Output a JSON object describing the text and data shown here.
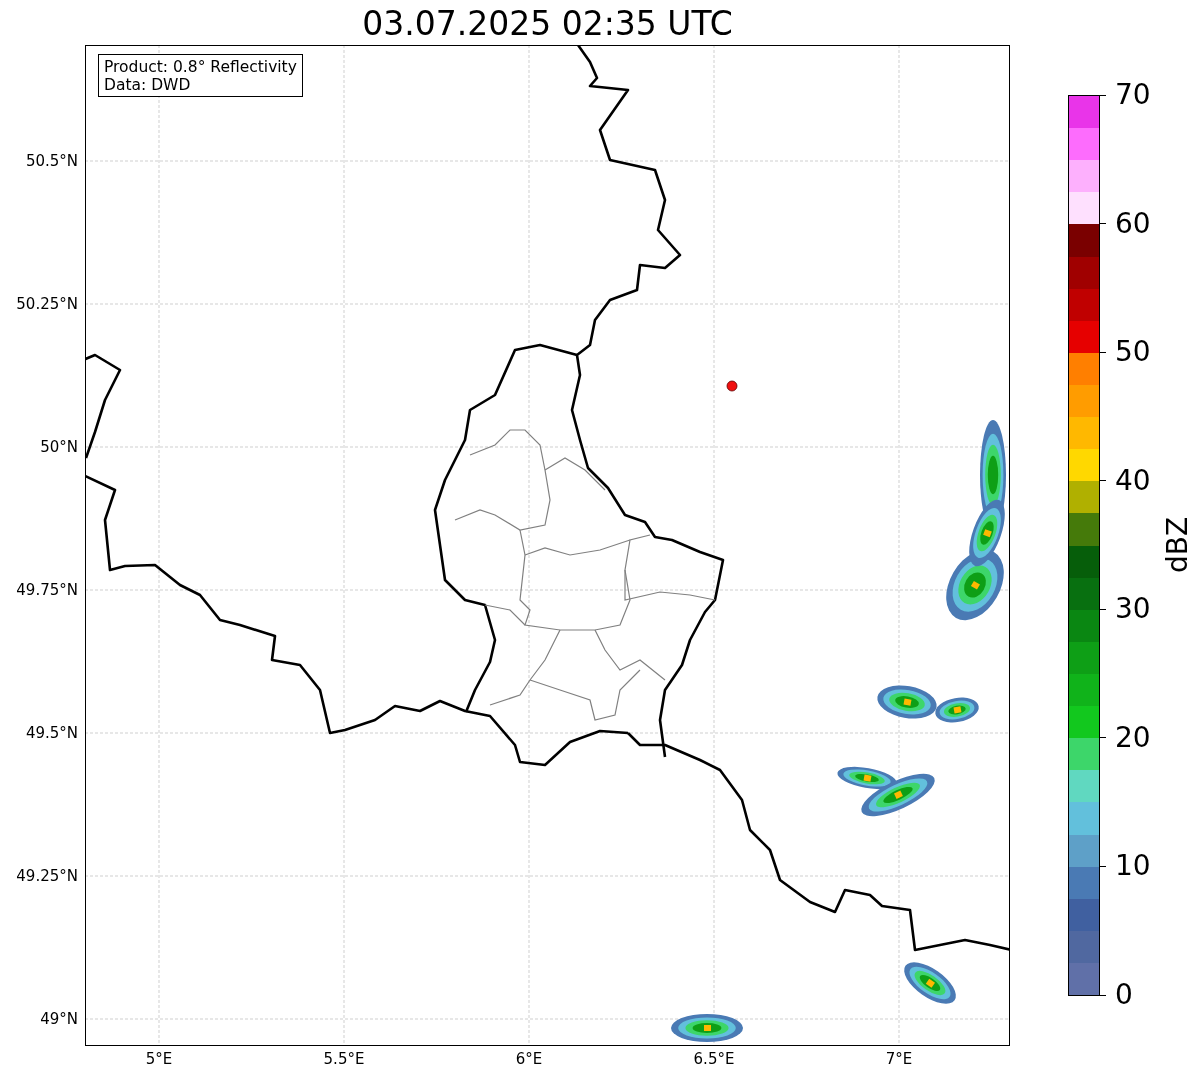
{
  "title": "03.07.2025 02:35 UTC",
  "map": {
    "info_box": [
      "Product: 0.8° Reflectivity",
      "Data: DWD"
    ],
    "xticks": [
      "5°E",
      "5.5°E",
      "6°E",
      "6.5°E",
      "7°E"
    ],
    "yticks": [
      "50.5°N",
      "50.25°N",
      "50°N",
      "49.75°N",
      "49.5°N",
      "49.25°N",
      "49°N"
    ]
  },
  "colorbar": {
    "label": "dBZ",
    "ticks": [
      "70",
      "60",
      "50",
      "40",
      "30",
      "20",
      "10",
      "0"
    ],
    "bands": [
      {
        "color": "#e934e9"
      },
      {
        "color": "#fd6cfd"
      },
      {
        "color": "#fdb0fd"
      },
      {
        "color": "#fee0fe"
      },
      {
        "color": "#7a0000"
      },
      {
        "color": "#a00000"
      },
      {
        "color": "#c00000"
      },
      {
        "color": "#e60000"
      },
      {
        "color": "#ff7f00"
      },
      {
        "color": "#ff9c00"
      },
      {
        "color": "#ffb800"
      },
      {
        "color": "#ffd800"
      },
      {
        "color": "#b0b000"
      },
      {
        "color": "#457a0a"
      },
      {
        "color": "#065e0a"
      },
      {
        "color": "#087010"
      },
      {
        "color": "#0a8712"
      },
      {
        "color": "#0e9f16"
      },
      {
        "color": "#10b31a"
      },
      {
        "color": "#12c81e"
      },
      {
        "color": "#3dd66a"
      },
      {
        "color": "#60d8c0"
      },
      {
        "color": "#62c0dc"
      },
      {
        "color": "#5ea0c8"
      },
      {
        "color": "#4a7ab4"
      },
      {
        "color": "#4060a0"
      },
      {
        "color": "#5068a0"
      },
      {
        "color": "#6070a8"
      }
    ]
  }
}
